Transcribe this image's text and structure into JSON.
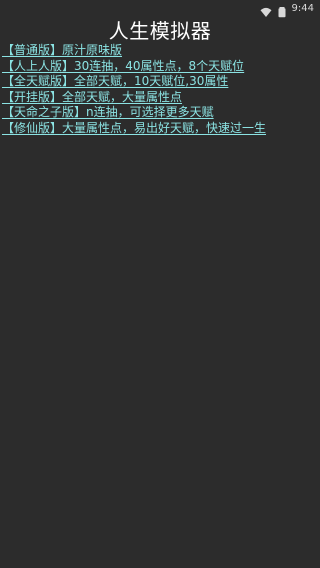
{
  "status_bar": {
    "time": "9:44",
    "icons": [
      "wifi-icon",
      "battery-icon"
    ]
  },
  "page": {
    "title": "人生模拟器"
  },
  "menu": {
    "items": [
      {
        "label": "【普通版】原汁原味版"
      },
      {
        "label": "【人上人版】30连抽，40属性点，8个天赋位"
      },
      {
        "label": "【全天赋版】全部天赋，10天赋位,30属性"
      },
      {
        "label": "【开挂版】全部天赋，大量属性点"
      },
      {
        "label": "【天命之子版】n连抽，可选择更多天赋"
      },
      {
        "label": "【修仙版】大量属性点，易出好天赋，快速过一生"
      }
    ]
  },
  "colors": {
    "background": "#2c2c2c",
    "link": "#8be3e3",
    "title": "#ffffff"
  }
}
